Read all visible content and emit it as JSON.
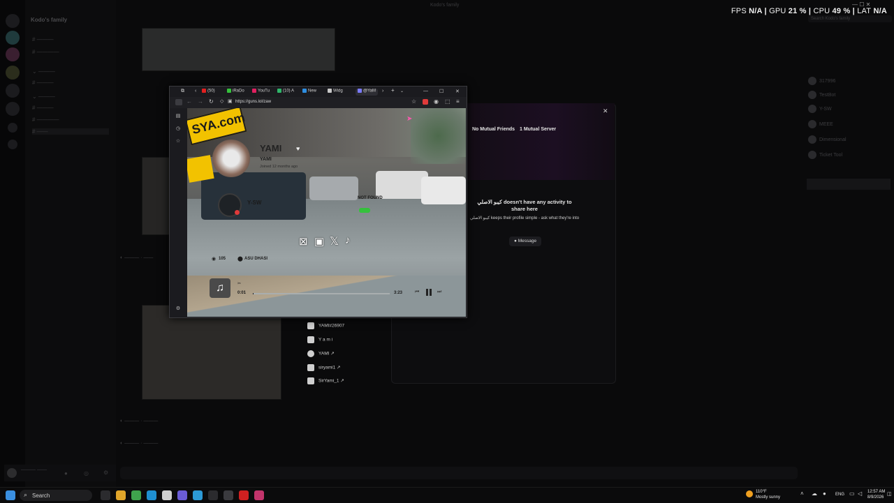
{
  "overlay": {
    "fps_label": "FPS",
    "fps_value": "N/A",
    "gpu_label": "GPU",
    "gpu_value": "21 %",
    "cpu_label": "CPU",
    "cpu_value": "49 %",
    "lat_label": "LAT",
    "lat_value": "N/A"
  },
  "discord": {
    "server_name": "Kodo's family",
    "window_title": "Kodo's family",
    "search_placeholder": "Search Kodo's family",
    "members": [
      "317996",
      "TestBot",
      "Y-SW",
      "MEEE",
      "Dimensional",
      "Ticket Tool"
    ]
  },
  "browser": {
    "tabs": [
      "(50)",
      "iRaDo",
      "YouTu",
      "(10) A",
      "New",
      "Widg",
      "@YaM"
    ],
    "url": "https://guns.lol/zaw"
  },
  "guns_page": {
    "name": "YAMI",
    "handle": "YAMI",
    "joined": "Joined 12 months ago",
    "song_artist": "Y-SW",
    "song_status": "NOT FOUND",
    "views": "105",
    "location": "ASU DHASI",
    "time_current": "0:01",
    "time_total": "3:23",
    "sign_text": "SYA.com"
  },
  "profile": {
    "mutual_friends": "No Mutual Friends",
    "mutual_servers": "1 Mutual Server",
    "no_activity": "كيبو الاصلي doesn't have any activity to share here",
    "keeps_private": "كيبو الاصلي keeps their profile simple - ask what they're into",
    "message_button": "Message",
    "connections": [
      "YAMI#26907",
      "Y a m i",
      "YAMI ↗",
      "siryami1 ↗",
      "SirYami_1 ↗"
    ]
  },
  "taskbar": {
    "search": "Search",
    "weather_temp": "110°F",
    "weather_desc": "Mostly sunny",
    "lang": "ENG",
    "time": "12:57 AM",
    "date": "8/9/2026"
  },
  "colors": {
    "discord_bg": "#0a0a0b",
    "browser_chrome": "#1b1b1f",
    "overlay_text": "#f2f2f2",
    "sign_yellow": "#f2c200"
  }
}
